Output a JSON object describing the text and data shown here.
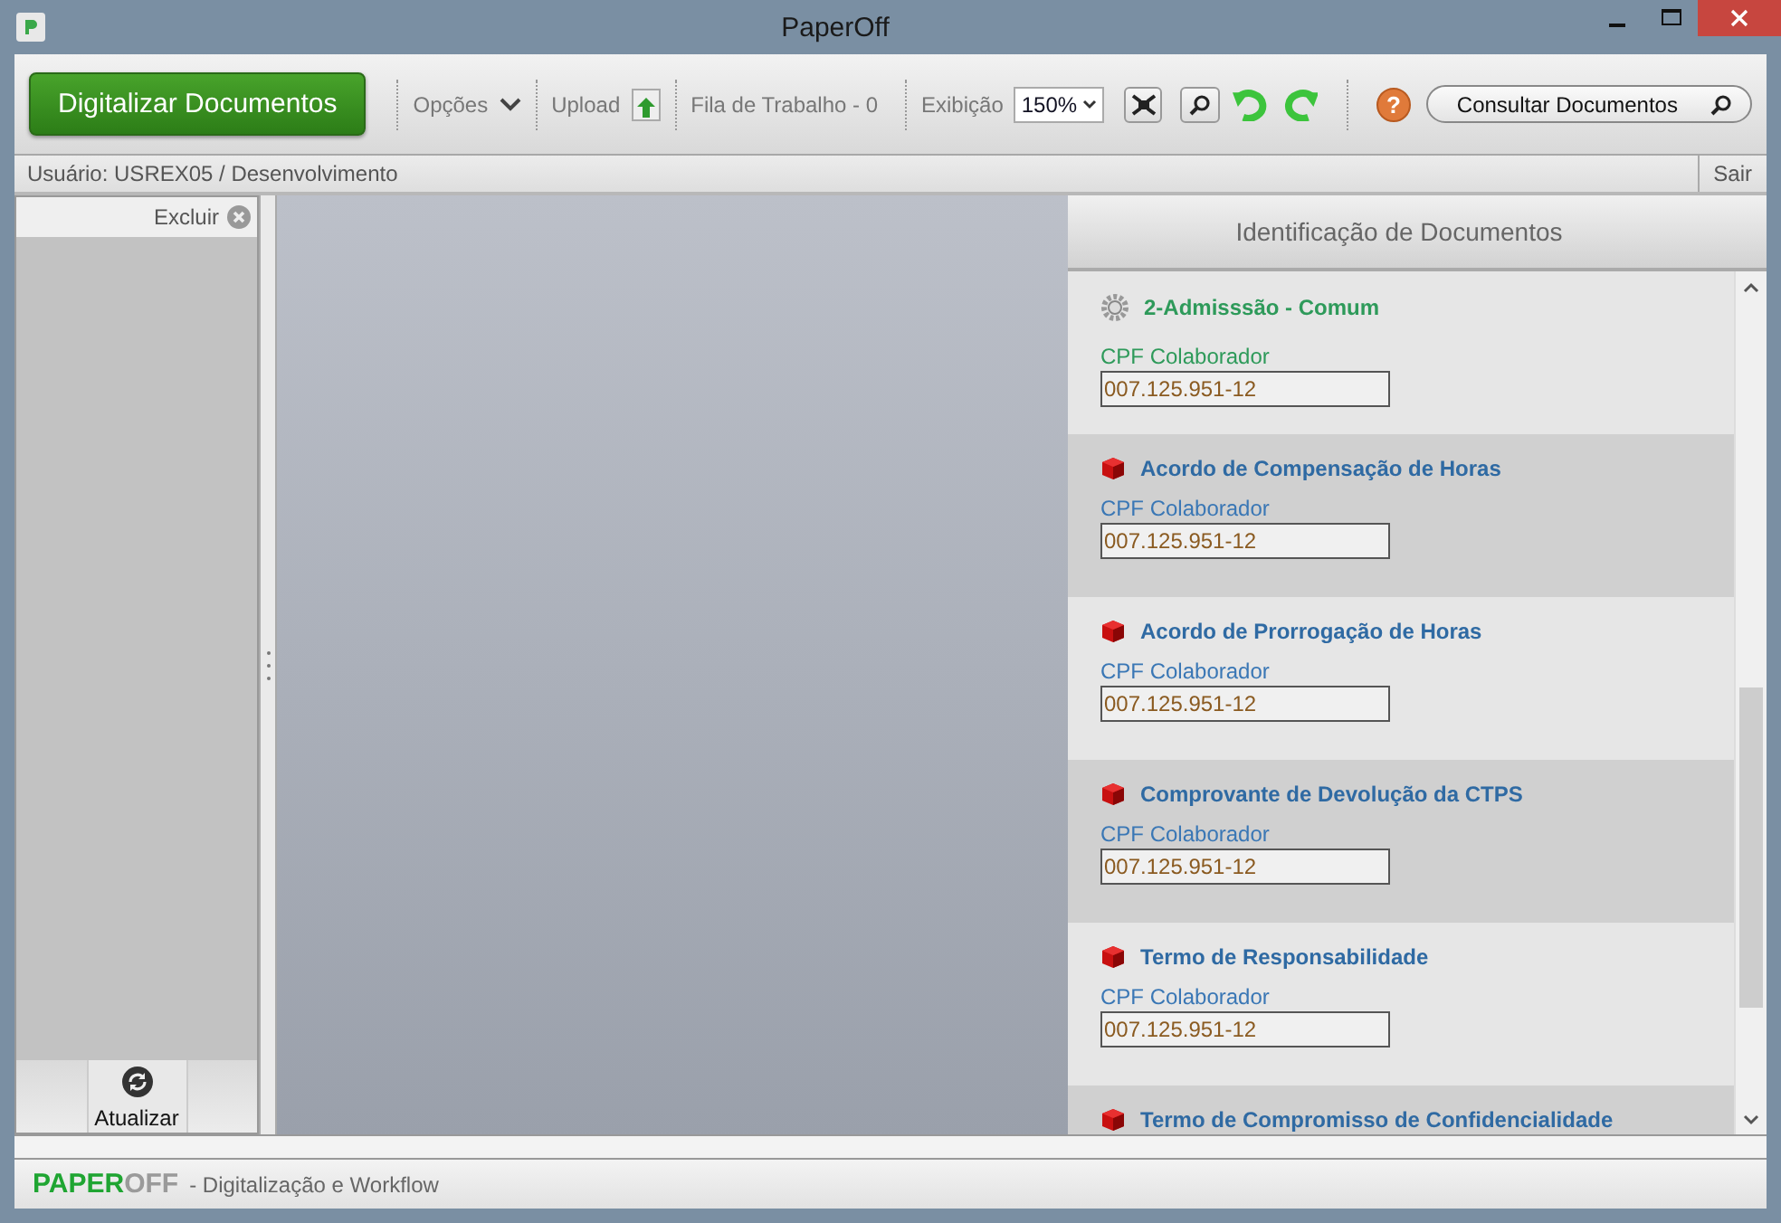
{
  "window": {
    "title": "PaperOff"
  },
  "toolbar": {
    "primary_button": "Digitalizar Documentos",
    "options": "Opções",
    "upload": "Upload",
    "queue": "Fila de Trabalho - 0",
    "zoom_label": "Exibição",
    "zoom_value": "150%",
    "search_button": "Consultar Documentos",
    "help": "?"
  },
  "user_bar": {
    "user": "Usuário: USREX05 / Desenvolvimento",
    "logout": "Sair"
  },
  "left_panel": {
    "delete": "Excluir",
    "refresh": "Atualizar"
  },
  "right_panel": {
    "title": "Identificação de Documentos",
    "items": [
      {
        "kind": "group",
        "title": "2-Admisssão - Comum",
        "field_label": "CPF Colaborador",
        "field_value": "007.125.951-12"
      },
      {
        "kind": "document",
        "title": "Acordo de Compensação de Horas",
        "field_label": "CPF Colaborador",
        "field_value": "007.125.951-12"
      },
      {
        "kind": "document",
        "title": "Acordo de Prorrogação de Horas",
        "field_label": "CPF Colaborador",
        "field_value": "007.125.951-12"
      },
      {
        "kind": "document",
        "title": "Comprovante de Devolução da CTPS",
        "field_label": "CPF Colaborador",
        "field_value": "007.125.951-12"
      },
      {
        "kind": "document",
        "title": "Termo de Responsabilidade",
        "field_label": "CPF Colaborador",
        "field_value": "007.125.951-12"
      },
      {
        "kind": "document",
        "title": "Termo de Compromisso de Confidencialidade"
      }
    ]
  },
  "footer": {
    "logo_primary": "PAPER",
    "logo_secondary": "OFF",
    "tagline": "- Digitalização e Workflow"
  }
}
